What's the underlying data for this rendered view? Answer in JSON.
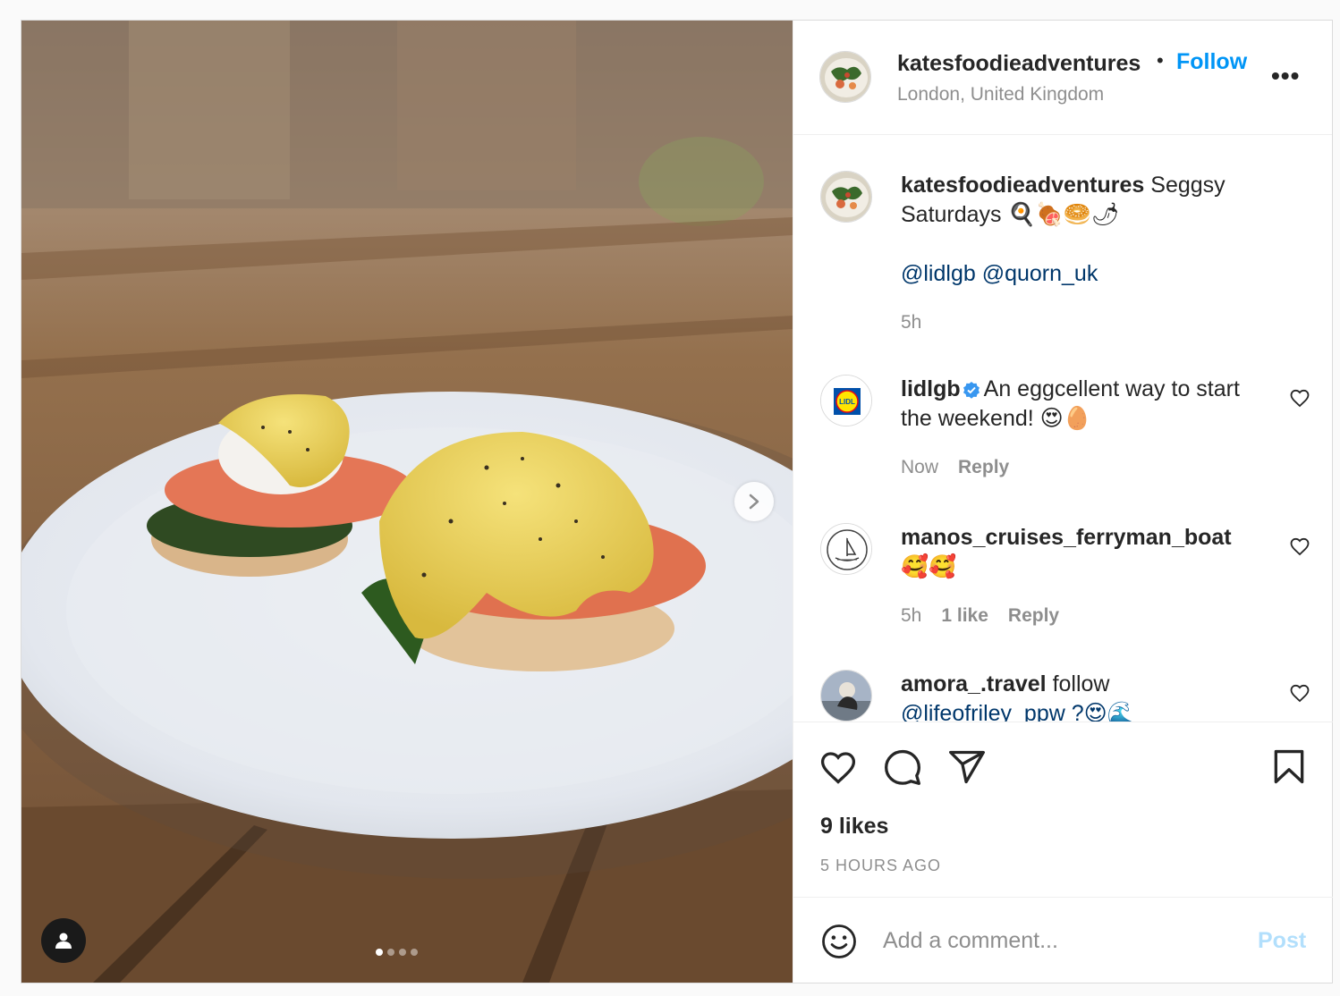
{
  "post": {
    "author": "katesfoodieadventures",
    "separator": "•",
    "follow_label": "Follow",
    "location": "London, United Kingdom",
    "more_label": "•••",
    "caption": {
      "username": "katesfoodieadventures",
      "text": " Seggsy Saturdays 🍳🍖🥯🌶",
      "mentions": "@lidlgb @quorn_uk",
      "time": "5h"
    },
    "comments": [
      {
        "username": "lidlgb",
        "verified": true,
        "text": "An eggcellent way to start the weekend! 😍🥚",
        "time": "Now",
        "likes": "",
        "reply_label": "Reply"
      },
      {
        "username": "manos_cruises_ferryman_boat",
        "verified": false,
        "text": "🥰🥰",
        "time": "5h",
        "likes": "1 like",
        "reply_label": "Reply"
      },
      {
        "username": "amora_.travel",
        "verified": false,
        "text": "follow",
        "mention": "@lifeofriley_ppw ?😍🌊"
      }
    ],
    "likes_label": "9 likes",
    "timestamp": "5 HOURS AGO",
    "composer": {
      "placeholder": "Add a comment...",
      "post_label": "Post"
    },
    "carousel": {
      "slides": 4,
      "current": 1
    },
    "colors": {
      "accent": "#0095f6",
      "mention": "#00376b",
      "muted": "#8e8e8e",
      "post_disabled": "#b2dffc"
    },
    "icons": {
      "like": "heart-icon",
      "comment": "comment-icon",
      "share": "send-icon",
      "save": "bookmark-icon",
      "emoji": "emoji-icon",
      "next": "chevron-right-icon",
      "tag": "user-tag-icon"
    }
  }
}
